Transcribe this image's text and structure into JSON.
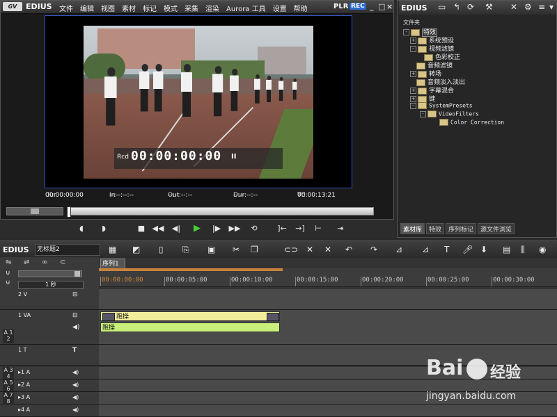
{
  "player": {
    "app_name": "EDIUS",
    "logo": "GV",
    "menu": [
      "文件",
      "编辑",
      "视图",
      "素材",
      "标记",
      "模式",
      "采集",
      "渲染",
      "Aurora 工具",
      "设置",
      "帮助"
    ],
    "mode_plr": "PLR",
    "mode_rec": "REC",
    "window_buttons": [
      "_",
      "□",
      "×"
    ],
    "overlay": {
      "rcd_label": "Rcd",
      "timecode": "00:00:00:00",
      "suffix": "II"
    },
    "readouts": {
      "cur_label": "Cur",
      "cur_value": "00:00:00:00",
      "in_label": "In",
      "in_value": "--:--:--:--",
      "out_label": "Out",
      "out_value": "--:--:--:--",
      "dur_label": "Dur",
      "dur_value": "--:--:--:--",
      "ttl_label": "Ttl",
      "ttl_value": "00:00:13:21"
    }
  },
  "bin": {
    "app_name": "EDIUS",
    "caption": "文件夹",
    "tree": [
      {
        "label": "特效",
        "pm": "-",
        "mono": false
      },
      {
        "label": "系统预设",
        "pm": "+",
        "mono": false
      },
      {
        "label": "视频滤镜",
        "pm": "-",
        "mono": false
      },
      {
        "label": "色彩校正",
        "pm": "",
        "mono": false
      },
      {
        "label": "音频滤镜",
        "pm": "",
        "mono": false
      },
      {
        "label": "转场",
        "pm": "+",
        "mono": false
      },
      {
        "label": "音频淡入淡出",
        "pm": "",
        "mono": false
      },
      {
        "label": "字幕混合",
        "pm": "+",
        "mono": false
      },
      {
        "label": "键",
        "pm": "+",
        "mono": false
      },
      {
        "label": "SystemPresets",
        "pm": "-",
        "mono": true
      },
      {
        "label": "VideoFilters",
        "pm": "-",
        "mono": true
      },
      {
        "label": "Color Correction",
        "pm": "",
        "mono": true
      }
    ],
    "tabs": [
      "素材库",
      "特效",
      "序列标记",
      "源文件浏览"
    ]
  },
  "timeline": {
    "app_name": "EDIUS",
    "project_name": "无标题2",
    "sequence_tab": "序列1",
    "scale": "1 秒",
    "ruler": [
      "00:00:00:00",
      "00:00:05:00",
      "00:00:10:00",
      "00:00:15:00",
      "00:00:20:00",
      "00:00:25:00",
      "00:00:30:00"
    ],
    "tracks": [
      {
        "name": "2 V",
        "side": ""
      },
      {
        "name": "1 VA",
        "side": "A 1 2"
      },
      {
        "name": "1 T",
        "side": ""
      },
      {
        "name": "▸1 A",
        "side": "A 3 4"
      },
      {
        "name": "▸2 A",
        "side": "A 5 6"
      },
      {
        "name": "▸3 A",
        "side": "A 7 8"
      },
      {
        "name": "▸4 A",
        "side": ""
      }
    ],
    "clip_video_label": "跑操",
    "clip_audio_label": "跑操"
  },
  "watermark": {
    "brand": "Bai",
    "brand_cn": "经验",
    "url": "jingyan.baidu.com"
  }
}
